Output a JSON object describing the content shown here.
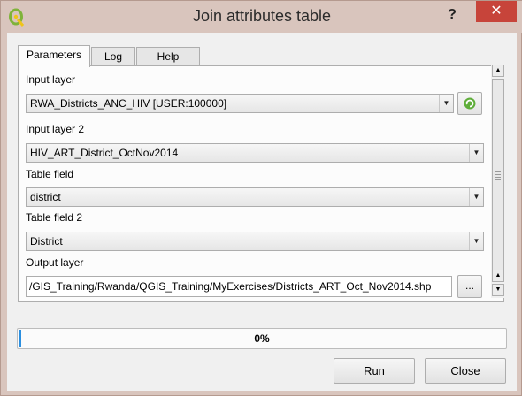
{
  "window": {
    "title": "Join attributes table",
    "help_symbol": "?",
    "close_symbol": "✕"
  },
  "tabs": [
    {
      "label": "Parameters",
      "active": true
    },
    {
      "label": "Log",
      "active": false
    },
    {
      "label": "Help",
      "active": false
    }
  ],
  "params": {
    "input_layer_label": "Input layer",
    "input_layer_value": "RWA_Districts_ANC_HIV [USER:100000]",
    "input_layer2_label": "Input layer 2",
    "input_layer2_value": "HIV_ART_District_OctNov2014",
    "table_field_label": "Table field",
    "table_field_value": "district",
    "table_field2_label": "Table field 2",
    "table_field2_value": "District",
    "output_layer_label": "Output layer",
    "output_layer_value": "/GIS_Training/Rwanda/QGIS_Training/MyExercises/Districts_ART_Oct_Nov2014.shp",
    "browse_label": "..."
  },
  "progress": {
    "text": "0%",
    "fraction": 0
  },
  "buttons": {
    "run": "Run",
    "close": "Close"
  },
  "colors": {
    "titlebar": "#d9c5bd",
    "close_red": "#c7443a",
    "progress_blue": "#2b8fe0"
  }
}
